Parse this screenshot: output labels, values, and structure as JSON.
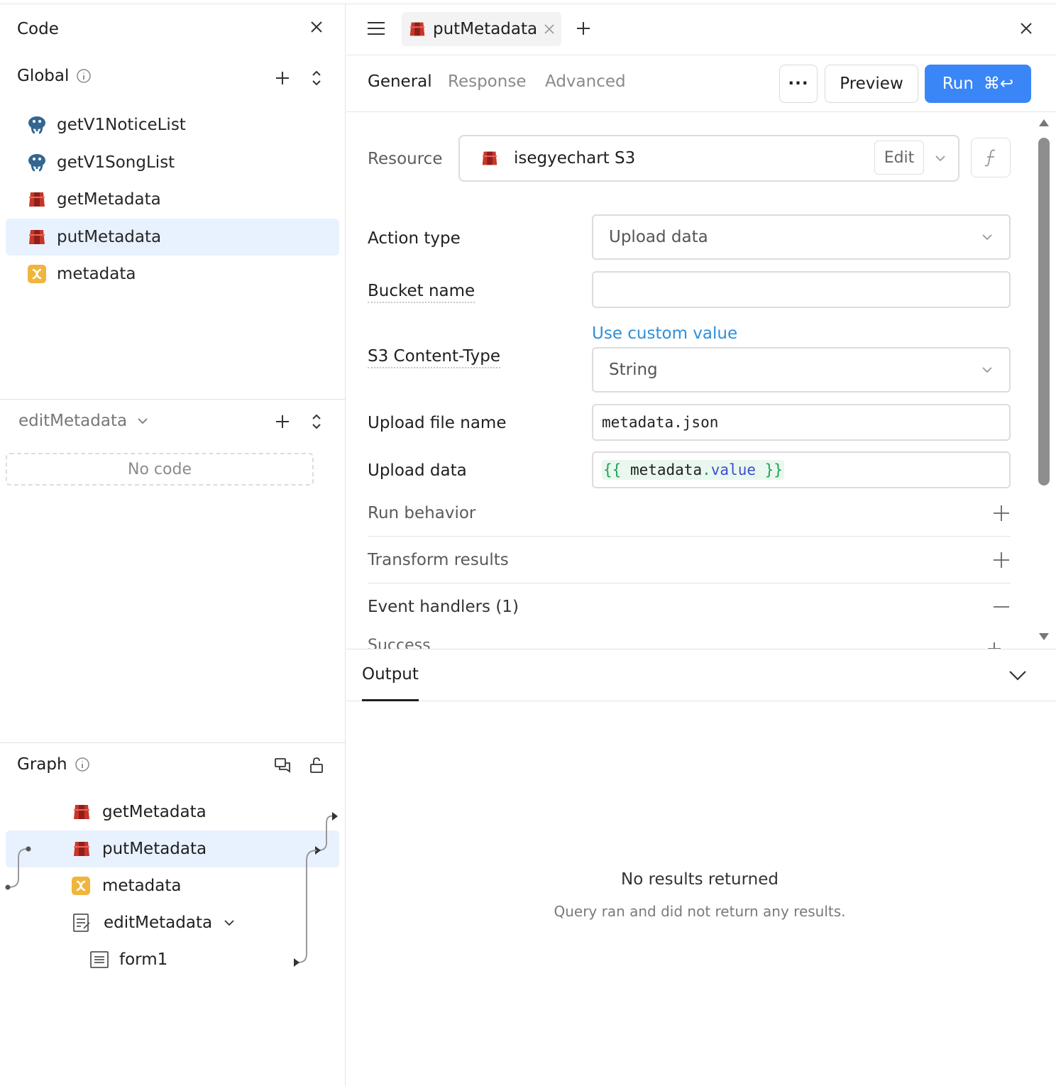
{
  "left": {
    "code_title": "Code",
    "global_title": "Global",
    "global_items": [
      {
        "label": "getV1NoticeList",
        "icon": "postgres-icon"
      },
      {
        "label": "getV1SongList",
        "icon": "postgres-icon"
      },
      {
        "label": "getMetadata",
        "icon": "s3-icon"
      },
      {
        "label": "putMetadata",
        "icon": "s3-icon"
      },
      {
        "label": "metadata",
        "icon": "variable-icon"
      }
    ],
    "scope_title": "editMetadata",
    "no_code": "No code",
    "graph_title": "Graph",
    "graph_items": [
      {
        "label": "getMetadata",
        "icon": "s3-icon"
      },
      {
        "label": "putMetadata",
        "icon": "s3-icon"
      },
      {
        "label": "metadata",
        "icon": "variable-icon"
      },
      {
        "label": "editMetadata",
        "icon": "modal-icon"
      },
      {
        "label": "form1",
        "icon": "form-icon"
      }
    ]
  },
  "right": {
    "file_tab": "putMetadata",
    "tabs": [
      "General",
      "Response",
      "Advanced"
    ],
    "more_label": "···",
    "preview_label": "Preview",
    "run_label": "Run",
    "run_shortcut": "⌘↩",
    "resource_label": "Resource",
    "resource_value": "isegyechart S3",
    "edit_label": "Edit",
    "action_type_label": "Action type",
    "action_type_value": "Upload data",
    "bucket_label": "Bucket name",
    "bucket_value": "",
    "custom_value_link": "Use custom value",
    "content_type_label": "S3 Content-Type",
    "content_type_value": "String",
    "file_name_label": "Upload file name",
    "file_name_value": "metadata.json",
    "upload_data_label": "Upload data",
    "upload_data_open": "{{",
    "upload_data_obj": "metadata",
    "upload_data_dot": ".",
    "upload_data_prop": "value",
    "upload_data_close": "}}",
    "run_behavior": "Run behavior",
    "transform_results": "Transform results",
    "event_handlers": "Event handlers (1)",
    "success": "Success",
    "output_title": "Output",
    "empty_title": "No results returned",
    "empty_sub": "Query ran and did not return any results."
  },
  "colors": {
    "accent": "#3a86f7",
    "selected": "#e8f1fe",
    "link": "#2f8fd8",
    "s3": "#c8352b",
    "variable": "#f0b53d",
    "postgres": "#336791"
  }
}
